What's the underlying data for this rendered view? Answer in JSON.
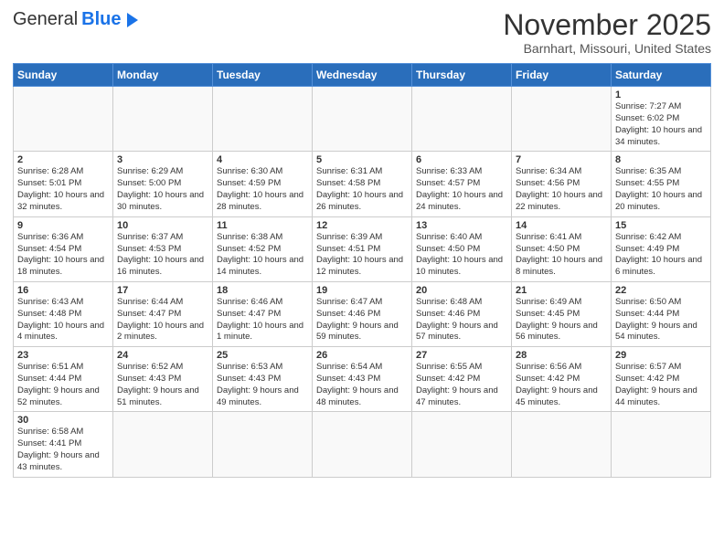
{
  "header": {
    "logo_general": "General",
    "logo_blue": "Blue",
    "title": "November 2025",
    "subtitle": "Barnhart, Missouri, United States"
  },
  "weekdays": [
    "Sunday",
    "Monday",
    "Tuesday",
    "Wednesday",
    "Thursday",
    "Friday",
    "Saturday"
  ],
  "weeks": [
    [
      {
        "day": "",
        "info": ""
      },
      {
        "day": "",
        "info": ""
      },
      {
        "day": "",
        "info": ""
      },
      {
        "day": "",
        "info": ""
      },
      {
        "day": "",
        "info": ""
      },
      {
        "day": "",
        "info": ""
      },
      {
        "day": "1",
        "info": "Sunrise: 7:27 AM\nSunset: 6:02 PM\nDaylight: 10 hours\nand 34 minutes."
      }
    ],
    [
      {
        "day": "2",
        "info": "Sunrise: 6:28 AM\nSunset: 5:01 PM\nDaylight: 10 hours\nand 32 minutes."
      },
      {
        "day": "3",
        "info": "Sunrise: 6:29 AM\nSunset: 5:00 PM\nDaylight: 10 hours\nand 30 minutes."
      },
      {
        "day": "4",
        "info": "Sunrise: 6:30 AM\nSunset: 4:59 PM\nDaylight: 10 hours\nand 28 minutes."
      },
      {
        "day": "5",
        "info": "Sunrise: 6:31 AM\nSunset: 4:58 PM\nDaylight: 10 hours\nand 26 minutes."
      },
      {
        "day": "6",
        "info": "Sunrise: 6:33 AM\nSunset: 4:57 PM\nDaylight: 10 hours\nand 24 minutes."
      },
      {
        "day": "7",
        "info": "Sunrise: 6:34 AM\nSunset: 4:56 PM\nDaylight: 10 hours\nand 22 minutes."
      },
      {
        "day": "8",
        "info": "Sunrise: 6:35 AM\nSunset: 4:55 PM\nDaylight: 10 hours\nand 20 minutes."
      }
    ],
    [
      {
        "day": "9",
        "info": "Sunrise: 6:36 AM\nSunset: 4:54 PM\nDaylight: 10 hours\nand 18 minutes."
      },
      {
        "day": "10",
        "info": "Sunrise: 6:37 AM\nSunset: 4:53 PM\nDaylight: 10 hours\nand 16 minutes."
      },
      {
        "day": "11",
        "info": "Sunrise: 6:38 AM\nSunset: 4:52 PM\nDaylight: 10 hours\nand 14 minutes."
      },
      {
        "day": "12",
        "info": "Sunrise: 6:39 AM\nSunset: 4:51 PM\nDaylight: 10 hours\nand 12 minutes."
      },
      {
        "day": "13",
        "info": "Sunrise: 6:40 AM\nSunset: 4:50 PM\nDaylight: 10 hours\nand 10 minutes."
      },
      {
        "day": "14",
        "info": "Sunrise: 6:41 AM\nSunset: 4:50 PM\nDaylight: 10 hours\nand 8 minutes."
      },
      {
        "day": "15",
        "info": "Sunrise: 6:42 AM\nSunset: 4:49 PM\nDaylight: 10 hours\nand 6 minutes."
      }
    ],
    [
      {
        "day": "16",
        "info": "Sunrise: 6:43 AM\nSunset: 4:48 PM\nDaylight: 10 hours\nand 4 minutes."
      },
      {
        "day": "17",
        "info": "Sunrise: 6:44 AM\nSunset: 4:47 PM\nDaylight: 10 hours\nand 2 minutes."
      },
      {
        "day": "18",
        "info": "Sunrise: 6:46 AM\nSunset: 4:47 PM\nDaylight: 10 hours\nand 1 minute."
      },
      {
        "day": "19",
        "info": "Sunrise: 6:47 AM\nSunset: 4:46 PM\nDaylight: 9 hours\nand 59 minutes."
      },
      {
        "day": "20",
        "info": "Sunrise: 6:48 AM\nSunset: 4:46 PM\nDaylight: 9 hours\nand 57 minutes."
      },
      {
        "day": "21",
        "info": "Sunrise: 6:49 AM\nSunset: 4:45 PM\nDaylight: 9 hours\nand 56 minutes."
      },
      {
        "day": "22",
        "info": "Sunrise: 6:50 AM\nSunset: 4:44 PM\nDaylight: 9 hours\nand 54 minutes."
      }
    ],
    [
      {
        "day": "23",
        "info": "Sunrise: 6:51 AM\nSunset: 4:44 PM\nDaylight: 9 hours\nand 52 minutes."
      },
      {
        "day": "24",
        "info": "Sunrise: 6:52 AM\nSunset: 4:43 PM\nDaylight: 9 hours\nand 51 minutes."
      },
      {
        "day": "25",
        "info": "Sunrise: 6:53 AM\nSunset: 4:43 PM\nDaylight: 9 hours\nand 49 minutes."
      },
      {
        "day": "26",
        "info": "Sunrise: 6:54 AM\nSunset: 4:43 PM\nDaylight: 9 hours\nand 48 minutes."
      },
      {
        "day": "27",
        "info": "Sunrise: 6:55 AM\nSunset: 4:42 PM\nDaylight: 9 hours\nand 47 minutes."
      },
      {
        "day": "28",
        "info": "Sunrise: 6:56 AM\nSunset: 4:42 PM\nDaylight: 9 hours\nand 45 minutes."
      },
      {
        "day": "29",
        "info": "Sunrise: 6:57 AM\nSunset: 4:42 PM\nDaylight: 9 hours\nand 44 minutes."
      }
    ],
    [
      {
        "day": "30",
        "info": "Sunrise: 6:58 AM\nSunset: 4:41 PM\nDaylight: 9 hours\nand 43 minutes."
      },
      {
        "day": "",
        "info": ""
      },
      {
        "day": "",
        "info": ""
      },
      {
        "day": "",
        "info": ""
      },
      {
        "day": "",
        "info": ""
      },
      {
        "day": "",
        "info": ""
      },
      {
        "day": "",
        "info": ""
      }
    ]
  ]
}
